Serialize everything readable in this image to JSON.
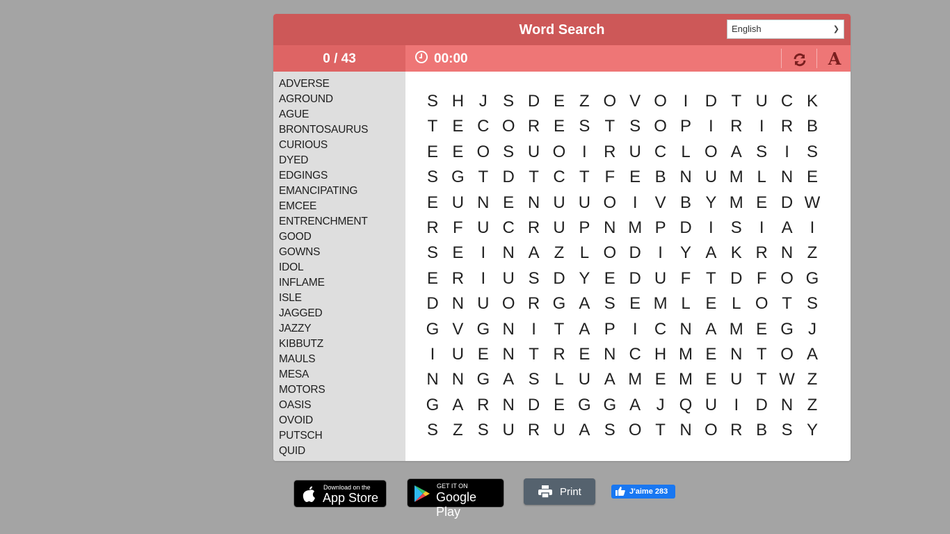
{
  "header": {
    "title": "Word Search",
    "language": {
      "selected": "English"
    }
  },
  "toolbar": {
    "found_count": "0 / 43",
    "timer": "00:00",
    "refresh_icon": "refresh-icon",
    "font_icon_label": "A"
  },
  "colors": {
    "title_bar": "#cd5858",
    "toolbar": "#ee7676",
    "counter_bg": "#de6464",
    "wordlist_bg": "#dedede",
    "icon_color": "#7a1f1f",
    "page_bg": "#a4a4a4"
  },
  "word_list": [
    "ADVERSE",
    "AGROUND",
    "AGUE",
    "BRONTOSAURUS",
    "CURIOUS",
    "DYED",
    "EDGINGS",
    "EMANCIPATING",
    "EMCEE",
    "ENTRENCHMENT",
    "GOOD",
    "GOWNS",
    "IDOL",
    "INFLAME",
    "ISLE",
    "JAGGED",
    "JAZZY",
    "KIBBUTZ",
    "MAULS",
    "MESA",
    "MOTORS",
    "OASIS",
    "OVOID",
    "PUTSCH",
    "QUID"
  ],
  "grid": [
    "SHJSDEZOVOIDTUCK",
    "TECORESTSOPIRIRB",
    "EEOSUOIRUCLOASIS",
    "SGTDTCTFEBNUMLNE",
    "EUNENUUOIVBYMEDW",
    "RFUCRUPNMPDISIAI",
    "SEINAZLODIYAKRNZ",
    "ERIUSDYEDUFTDFOG",
    "DNUORGASEMLELOTS",
    "GVGNITAPICNAMEGJ",
    "IUENTRENCHMENTOA",
    "NNGASLUAMEMEUTWZ",
    "GARNDEGGAJQUIDNZ",
    "SZSURUASOTNORBSY"
  ],
  "footer": {
    "app_store": {
      "small": "Download on the",
      "big": "App Store"
    },
    "google_play": {
      "small": "GET IT ON",
      "big": "Google Play"
    },
    "print_label": "Print",
    "like_label": "J'aime 283"
  }
}
